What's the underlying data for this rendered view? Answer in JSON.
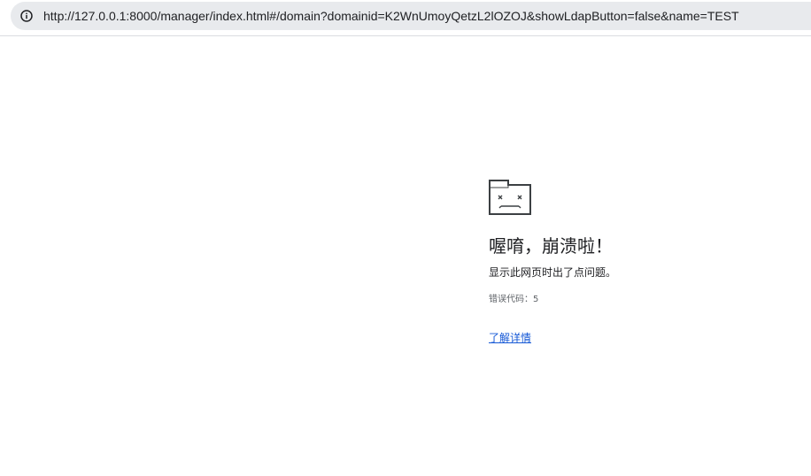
{
  "address_bar": {
    "url": "http://127.0.0.1:8000/manager/index.html#/domain?domainid=K2WnUmoyQetzL2lOZOJ&showLdapButton=false&name=TEST",
    "site_info_icon": "info-circle-icon"
  },
  "error_page": {
    "icon": "sad-tab-icon",
    "title": "喔唷，崩溃啦！",
    "description": "显示此网页时出了点问题。",
    "error_code": "错误代码：5",
    "learn_more_link": "了解详情",
    "colors": {
      "text": "#202124",
      "secondary_text": "#5f6368",
      "link": "#1558d6"
    }
  }
}
